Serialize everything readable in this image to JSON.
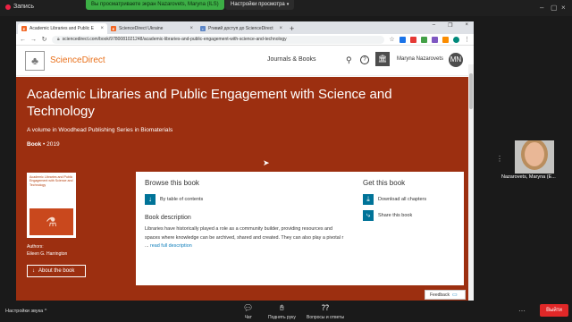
{
  "zoom": {
    "recording_label": "Запись",
    "share_banner": "Вы просматриваете экран Nazarovets, Maryna (ILS)",
    "view_options_label": "Настройки просмотра",
    "participant_name": "Nazarovets, Maryna (E...",
    "sound_settings": "Настройки звука",
    "chat_label": "Чат",
    "raise_hand_label": "Поднять руку",
    "qa_label": "Вопросы и ответы",
    "leave_label": "Выйти"
  },
  "browser": {
    "tabs": [
      {
        "label": "Academic Libraries and Public E",
        "icon": "elsevier-icon",
        "active": true
      },
      {
        "label": "ScienceDirect Ukraine",
        "icon": "elsevier-icon",
        "active": false
      },
      {
        "label": "Ргивий доступ до ScienceDirect",
        "icon": "page-icon",
        "active": false
      }
    ],
    "url": "sciencedirect.com/book/9780081021248/academic-libraries-and-public-engagement-with-science-and-technology"
  },
  "sd": {
    "brand": "ScienceDirect",
    "journals_books": "Journals & Books",
    "user_name": "Maryna Nazarovets",
    "avatar_initials": "MN"
  },
  "book": {
    "title": "Academic Libraries and Public Engagement with Science and Technology",
    "series": "A volume in Woodhead Publishing Series in Biomaterials",
    "type": "Book",
    "year": "2019",
    "cover_text": "Academic Libraries and Public Engagement with Science and Technology",
    "authors_label": "Authors:",
    "author": "Eileen G. Harrington",
    "about_button": "About the book",
    "browse_title": "Browse this book",
    "toc_label": "By table of contents",
    "description_title": "Book description",
    "description": "Libraries have historically played a role as a community builder, providing resources and spaces where knowledge can be archived, shared and created. They can also play a pivotal r ...",
    "read_more": "read full description",
    "get_title": "Get this book",
    "download_label": "Download all chapters",
    "share_label": "Share this book"
  },
  "feedback_label": "Feedback"
}
